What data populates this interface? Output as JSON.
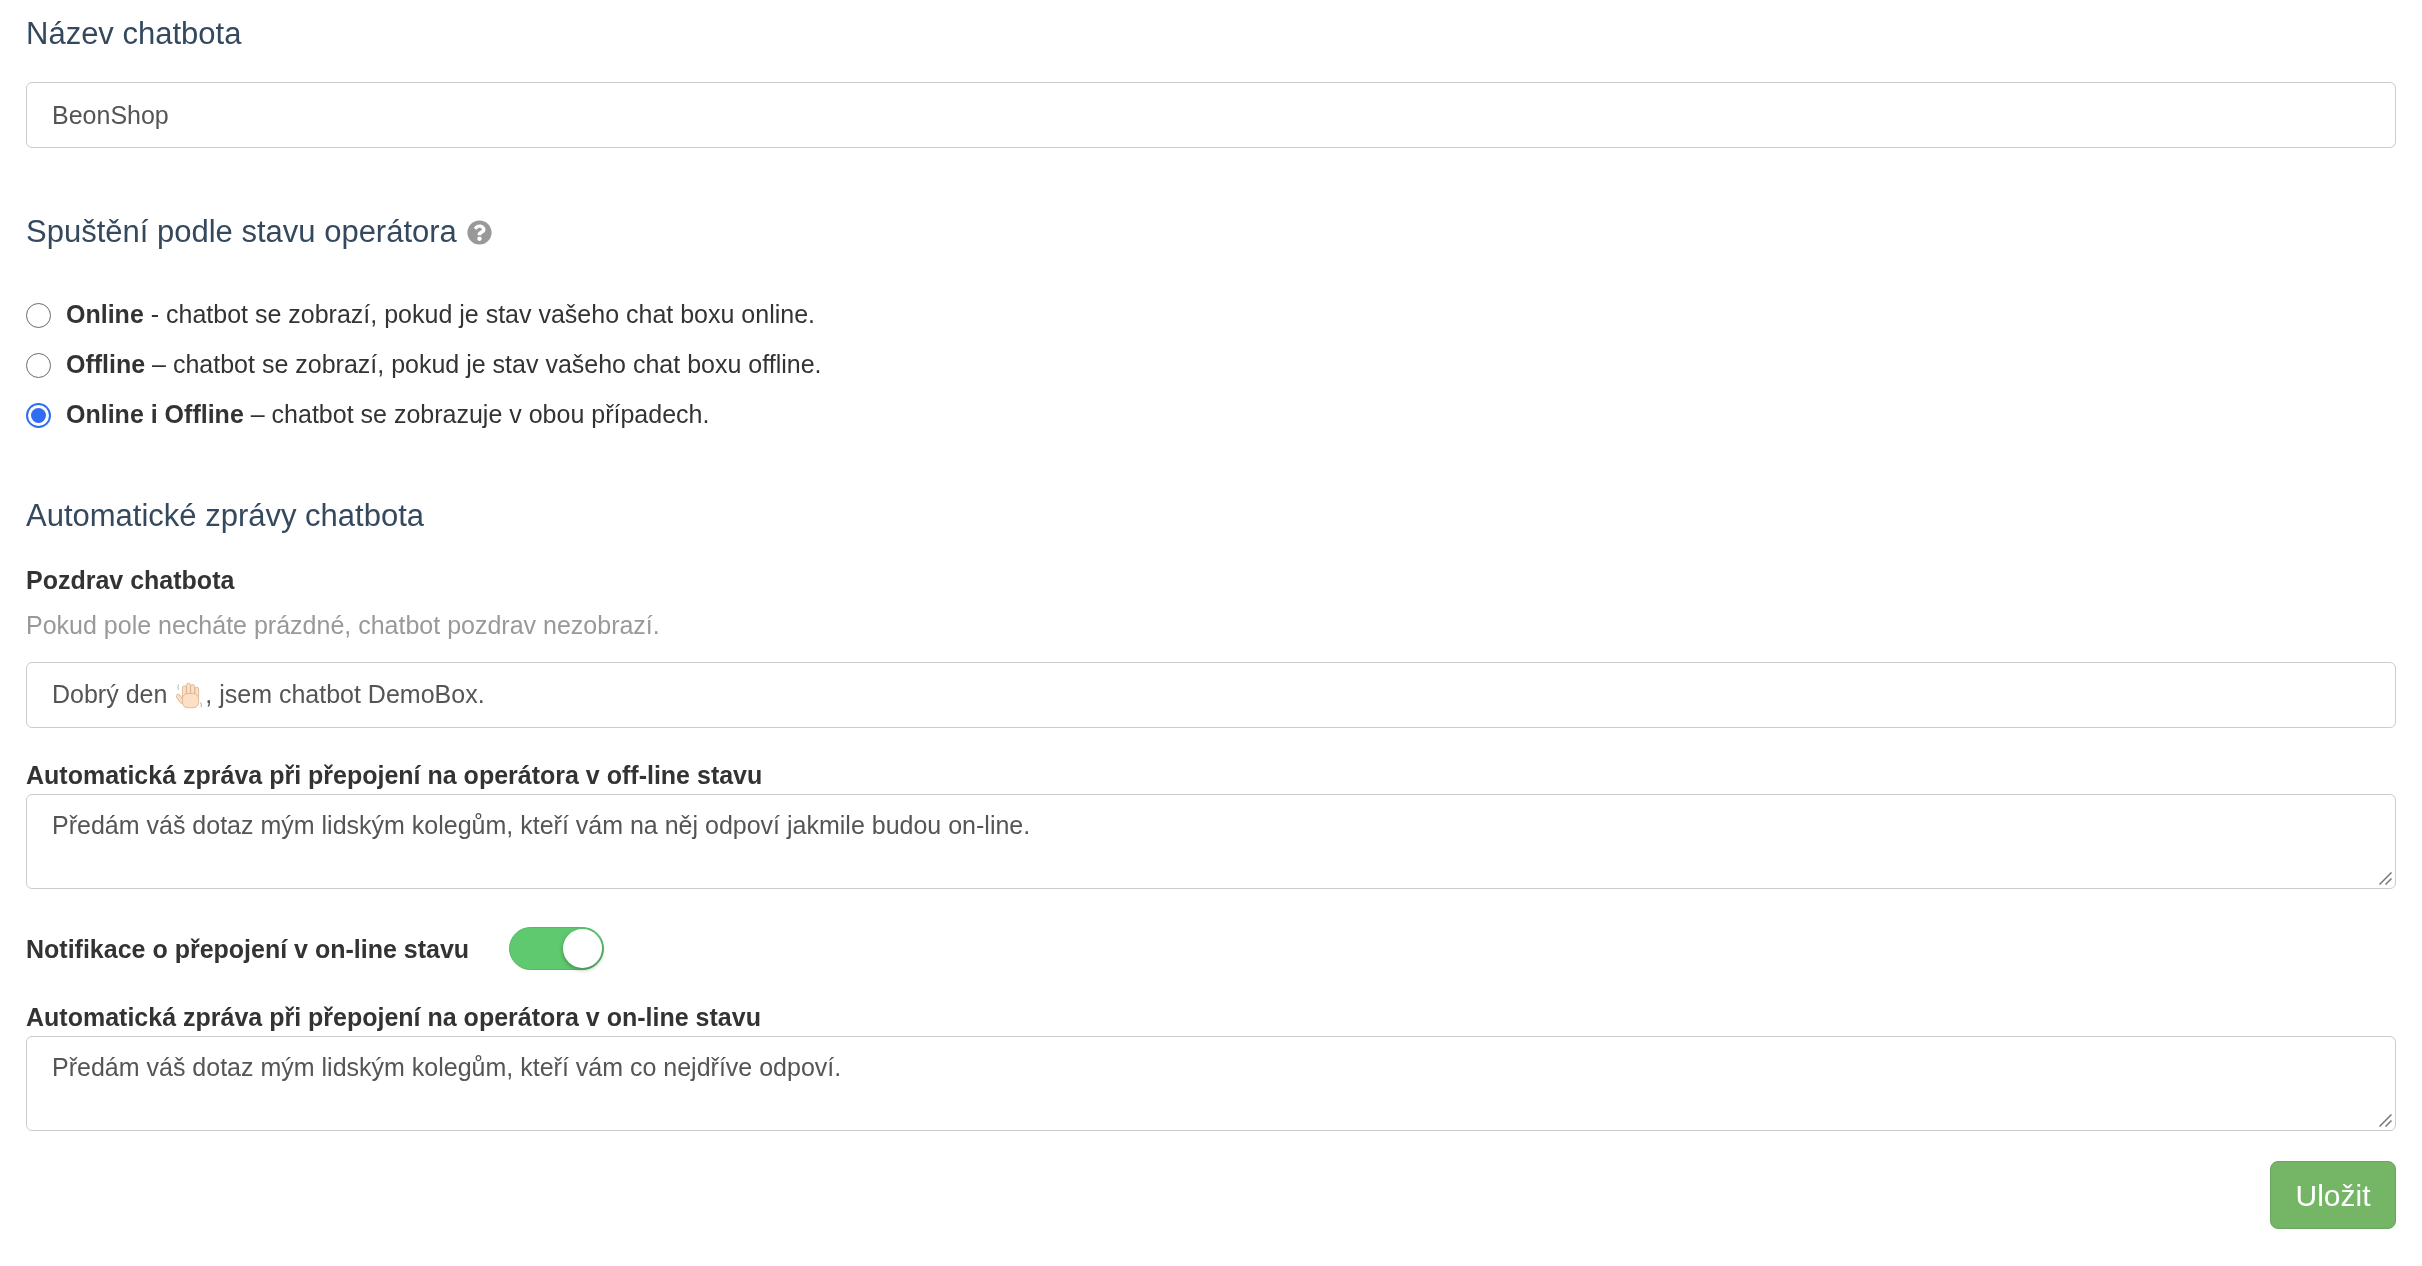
{
  "name_section": {
    "heading": "Název chatbota",
    "value": "BeonShop"
  },
  "trigger_section": {
    "heading": "Spuštění podle stavu operátora",
    "options": [
      {
        "text": "**Online** - chatbot se zobrazí, pokud je stav vašeho chat boxu online.",
        "selected": false
      },
      {
        "text": "**Offline** – chatbot se zobrazí, pokud je stav vašeho chat boxu offline.",
        "selected": false
      },
      {
        "text": "**Online i Offline** – chatbot se zobrazuje v obou případech.",
        "selected": true
      }
    ]
  },
  "messages_section": {
    "heading": "Automatické zprávy chatbota",
    "items": [
      {
        "kind": "input",
        "label": "Pozdrav chatbota",
        "hint": "Pokud pole necháte prázdné, chatbot pozdrav nezobrazí.",
        "value": [
          {
            "kind": "text",
            "text": "Dobrý den "
          },
          {
            "kind": "emoji"
          },
          {
            "kind": "text",
            "text": ", jsem chatbot DemoBox."
          }
        ]
      },
      {
        "kind": "textarea",
        "label": "Automatická zpráva při přepojení na operátora v off-line stavu",
        "value": "Předám váš dotaz mým lidským kolegům, kteří vám na něj odpoví jakmile budou on-line."
      },
      {
        "kind": "toggle",
        "label": "Notifikace o přepojení v on-line stavu",
        "on": true
      },
      {
        "kind": "textarea",
        "label": "Automatická zpráva při přepojení na operátora v on-line stavu",
        "value": "Předám váš dotaz mým lidským kolegům, kteří vám co nejdříve odpoví."
      }
    ]
  },
  "save_button": {
    "label": "Uložit"
  }
}
